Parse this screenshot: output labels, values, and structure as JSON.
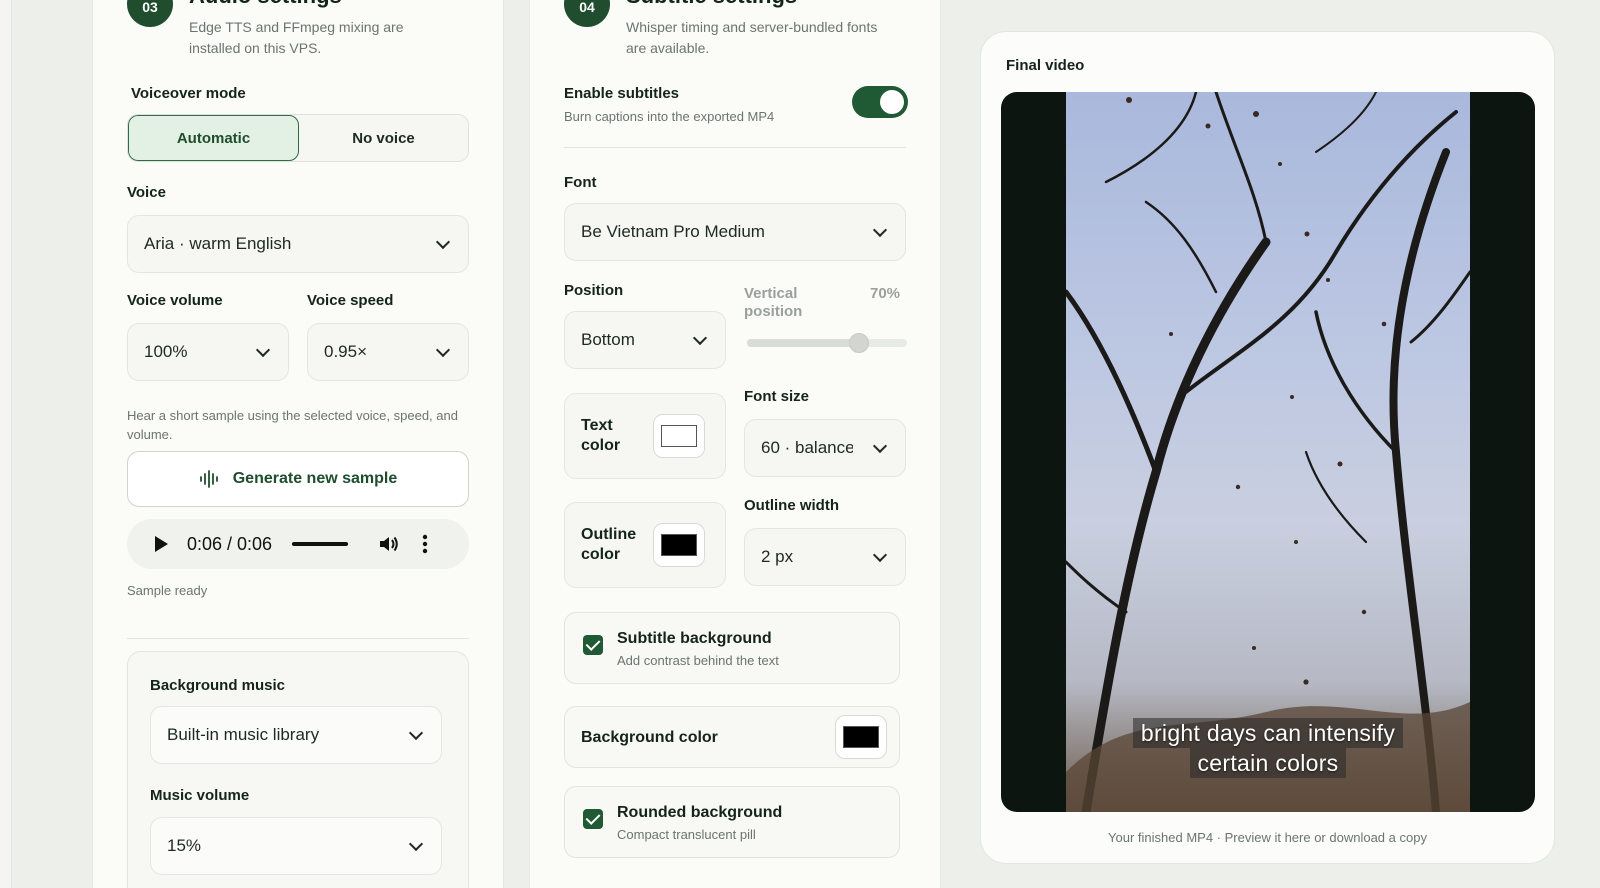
{
  "audio": {
    "step": "03",
    "title": "Audio settings",
    "description": "Edge TTS and FFmpeg mixing are installed on this VPS.",
    "voiceover_label": "Voiceover mode",
    "voiceover_options": [
      "Automatic",
      "No voice"
    ],
    "voice_label": "Voice",
    "voice_value": "Aria · warm English",
    "volume_label": "Voice volume",
    "volume_value": "100%",
    "speed_label": "Voice speed",
    "speed_value": "0.95×",
    "sample_hint": "Hear a short sample using the selected voice, speed, and volume.",
    "generate_label": "Generate new sample",
    "player_time": "0:06 / 0:06",
    "player_progress": 1.0,
    "sample_status": "Sample ready",
    "music_label": "Background music",
    "music_value": "Built-in music library",
    "music_volume_label": "Music volume",
    "music_volume_value": "15%"
  },
  "subtitles": {
    "step": "04",
    "title": "Subtitle settings",
    "description": "Whisper timing and server-bundled fonts are available.",
    "enable_label": "Enable subtitles",
    "enable_sub": "Burn captions into the exported MP4",
    "enabled": true,
    "font_label": "Font",
    "font_value": "Be Vietnam Pro Medium",
    "position_label": "Position",
    "position_value": "Bottom",
    "vertical_label": "Vertical position",
    "vertical_value": "70%",
    "vertical_fraction": 0.7,
    "text_color_label": "Text color",
    "text_color": "#ffffff",
    "font_size_label": "Font size",
    "font_size_value": "60 · balanced",
    "outline_color_label": "Outline color",
    "outline_color": "#000000",
    "outline_width_label": "Outline width",
    "outline_width_value": "2 px",
    "bg_title": "Subtitle background",
    "bg_sub": "Add contrast behind the text",
    "bg_color_label": "Background color",
    "bg_color": "#000000",
    "rounded_title": "Rounded background",
    "rounded_sub": "Compact translucent pill"
  },
  "preview": {
    "title": "Final video",
    "caption_line1": "bright days can intensify",
    "caption_line2": "certain colors",
    "footer": "Your finished MP4 · Preview it here or download a copy"
  },
  "colors": {
    "accent": "#1f5a35",
    "badge": "#1f4d2e"
  }
}
